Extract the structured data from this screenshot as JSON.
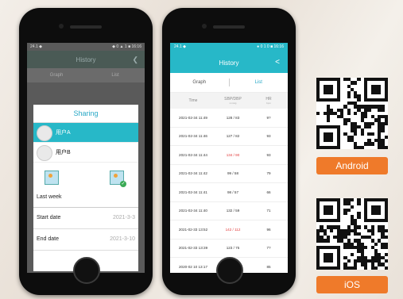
{
  "left_phone": {
    "status_left": "24.1 ◆",
    "status_right": "◆ 0 ▲ 1 ■ 16:16",
    "title": "History",
    "tabs": [
      "Graph",
      "List"
    ],
    "dialog": {
      "title": "Sharing",
      "users": [
        {
          "name": "用户A",
          "selected": true
        },
        {
          "name": "用户B",
          "selected": false
        }
      ],
      "period": "Last week",
      "start_label": "Start date",
      "start_value": "2021-3-3",
      "end_label": "End date",
      "end_value": "2021-3-10"
    }
  },
  "right_phone": {
    "status_left": "24.1 ◆",
    "status_right": "● 0 1 0 ■ 16:16",
    "title": "History",
    "tabs": [
      {
        "label": "Graph",
        "active": false
      },
      {
        "label": "List",
        "active": true
      }
    ],
    "columns": [
      {
        "label": "Time",
        "unit": ""
      },
      {
        "label": "SBP/DBP",
        "unit": "mmHg"
      },
      {
        "label": "HR",
        "unit": "bpm"
      }
    ],
    "rows": [
      {
        "time": "2021-02-34 11:49",
        "bp": "128 / 83",
        "hr": "9?",
        "sbp_high": false,
        "dbp_high": false
      },
      {
        "time": "2021-02-34 11:46",
        "bp": "127 / 82",
        "hr": "93",
        "sbp_high": false,
        "dbp_high": false
      },
      {
        "time": "2021-02-34 11:44",
        "bp": "134 / 90",
        "hr": "93",
        "sbp_high": false,
        "dbp_high": true
      },
      {
        "time": "2021-02-34 11:42",
        "bp": "99 / 58",
        "hr": "79",
        "sbp_high": false,
        "dbp_high": false
      },
      {
        "time": "2021-02-34 11:41",
        "bp": "98 / 57",
        "hr": "66",
        "sbp_high": false,
        "dbp_high": false
      },
      {
        "time": "2021-02-34 11:40",
        "bp": "132 / 59",
        "hr": "71",
        "sbp_high": false,
        "dbp_high": false
      },
      {
        "time": "2021-02-33 13:52",
        "bp": "142 / 112",
        "hr": "96",
        "sbp_high": true,
        "dbp_high": true
      },
      {
        "time": "2021-02-33 13:39",
        "bp": "123 / 75",
        "hr": "7?",
        "sbp_high": false,
        "dbp_high": false
      },
      {
        "time": "2020-02 10 13:17",
        "bp": "133 / 86",
        "hr": "85",
        "sbp_high": false,
        "dbp_high": false
      }
    ]
  },
  "downloads": [
    {
      "label": "Android",
      "color": "#ef7a2a"
    },
    {
      "label": "iOS",
      "color": "#ef7a2a"
    }
  ],
  "colors": {
    "accent": "#27b8c8",
    "badge": "#ef7a2a",
    "alert": "#e23b3b"
  }
}
